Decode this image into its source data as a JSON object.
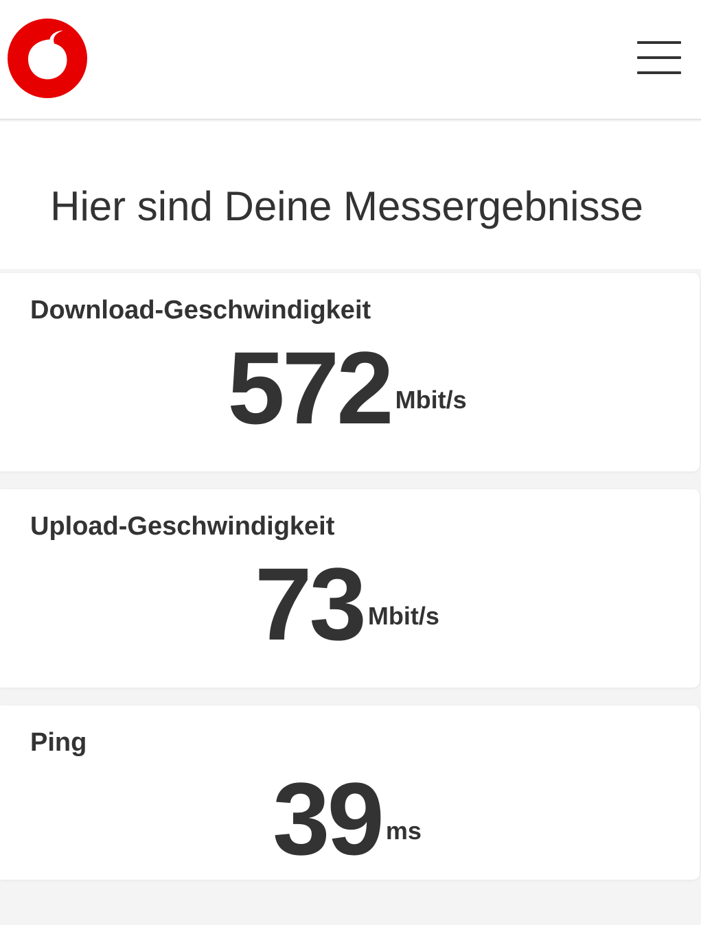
{
  "header": {
    "logo_name": "vodafone-logo",
    "brand_color": "#e60000",
    "menu_icon": "hamburger-menu-icon"
  },
  "page": {
    "title": "Hier sind Deine Messergebnisse"
  },
  "results": [
    {
      "label": "Download-Geschwindigkeit",
      "value": "572",
      "unit": "Mbit/s"
    },
    {
      "label": "Upload-Geschwindigkeit",
      "value": "73",
      "unit": "Mbit/s"
    },
    {
      "label": "Ping",
      "value": "39",
      "unit": "ms"
    }
  ],
  "colors": {
    "text": "#333333",
    "background": "#f4f4f4",
    "card": "#ffffff"
  }
}
